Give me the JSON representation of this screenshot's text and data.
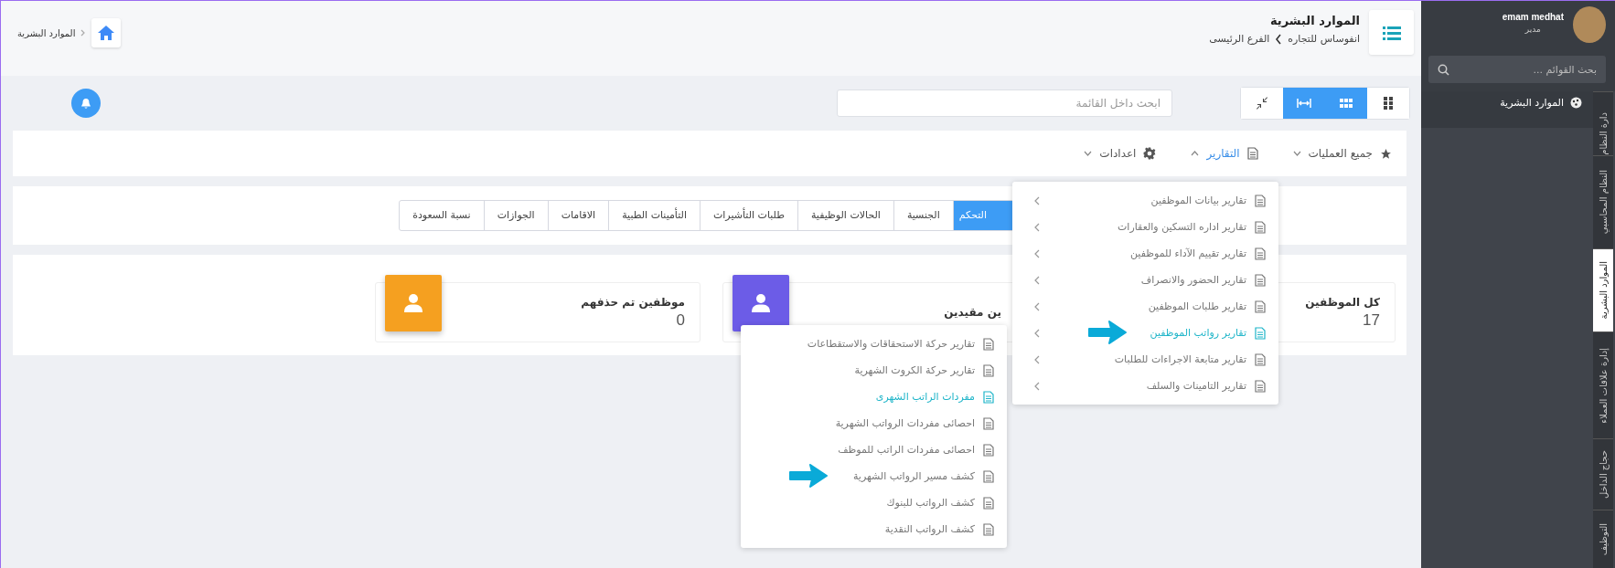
{
  "sidebar": {
    "user": {
      "name": "emam medhat",
      "role": "مدير"
    },
    "search": {
      "placeholder": "بحث القوائم ..."
    },
    "items": [
      {
        "label": "الموارد البشرية"
      }
    ],
    "vertical_tabs": [
      {
        "label": "دارة النظام",
        "selected": false
      },
      {
        "label": "النظام المحاسبي",
        "selected": false
      },
      {
        "label": "الموارد البشرية",
        "selected": true
      },
      {
        "label": "إدارة علاقات العملاء",
        "selected": false
      },
      {
        "label": "حجاج الداخل",
        "selected": false
      },
      {
        "label": "التوظيف",
        "selected": false
      }
    ]
  },
  "header": {
    "title": "الموارد البشرية",
    "breadcrumb": [
      "انفوساس للتجاره",
      "الفرع الرئيسى"
    ],
    "home_breadcrumb": "الموارد البشرية"
  },
  "toolbar": {
    "view_buttons": [
      {
        "kind": "grid-small",
        "selected": false
      },
      {
        "kind": "grid",
        "selected": true
      },
      {
        "kind": "expand",
        "selected": true
      },
      {
        "kind": "compress",
        "selected": false
      }
    ],
    "search": {
      "placeholder": "ابحث داخل القائمة"
    }
  },
  "menu": [
    {
      "kind": "star",
      "label": "جميع العمليات",
      "expanded": false,
      "selected": false
    },
    {
      "kind": "report",
      "label": "التقارير",
      "expanded": true,
      "selected": true
    },
    {
      "kind": "gear",
      "label": "اعدادات",
      "expanded": false,
      "selected": false
    }
  ],
  "tabs": [
    {
      "label": "التحكم",
      "selected": true
    },
    {
      "label": "الجنسية",
      "selected": false
    },
    {
      "label": "الحالات الوظيفية",
      "selected": false
    },
    {
      "label": "طلبات التأشيرات",
      "selected": false
    },
    {
      "label": "التأمينات الطبية",
      "selected": false
    },
    {
      "label": "الاقامات",
      "selected": false
    },
    {
      "label": "الجوازات",
      "selected": false
    },
    {
      "label": "نسبة السعودة",
      "selected": false
    }
  ],
  "cards": [
    {
      "title": "كل الموظفين",
      "value": "17"
    },
    {
      "title": "ين مقيدين",
      "color": "#6c5ce7"
    },
    {
      "title": "موظفين تم حذفهم",
      "value": "0",
      "color": "#f5a020"
    }
  ],
  "reports_menu": [
    {
      "label": "تقارير بيانات الموظفين",
      "selected": false,
      "pointed": false
    },
    {
      "label": "تقارير اداره التسكين والعقارات",
      "selected": false,
      "pointed": false
    },
    {
      "label": "تقارير تقييم الآداء للموظفين",
      "selected": false,
      "pointed": false
    },
    {
      "label": "تقارير الحضور والانصراف",
      "selected": false,
      "pointed": false
    },
    {
      "label": "تقارير طلبات الموظفين",
      "selected": false,
      "pointed": false
    },
    {
      "label": "تقارير رواتب الموظفين",
      "selected": true,
      "pointed": true
    },
    {
      "label": "تقارير متابعة الاجراءات للطلبات",
      "selected": false,
      "pointed": false
    },
    {
      "label": "تقارير التامينات والسلف",
      "selected": false,
      "pointed": false
    }
  ],
  "salary_submenu": [
    {
      "label": "تقارير حركة الاستحقاقات والاستقطاعات",
      "selected": false,
      "pointed": false
    },
    {
      "label": "تقارير حركة الكروت الشهرية",
      "selected": false,
      "pointed": false
    },
    {
      "label": "مفردات الراتب الشهرى",
      "selected": true,
      "pointed": false
    },
    {
      "label": "احصائى مفردات الرواتب الشهرية",
      "selected": false,
      "pointed": false
    },
    {
      "label": "احصائى مفردات الراتب للموظف",
      "selected": false,
      "pointed": false
    },
    {
      "label": "كشف مسير الرواتب الشهرية",
      "selected": false,
      "pointed": true
    },
    {
      "label": "كشف الرواتب للبنوك",
      "selected": false,
      "pointed": false
    },
    {
      "label": "كشف الرواتب النقدية",
      "selected": false,
      "pointed": false
    }
  ]
}
